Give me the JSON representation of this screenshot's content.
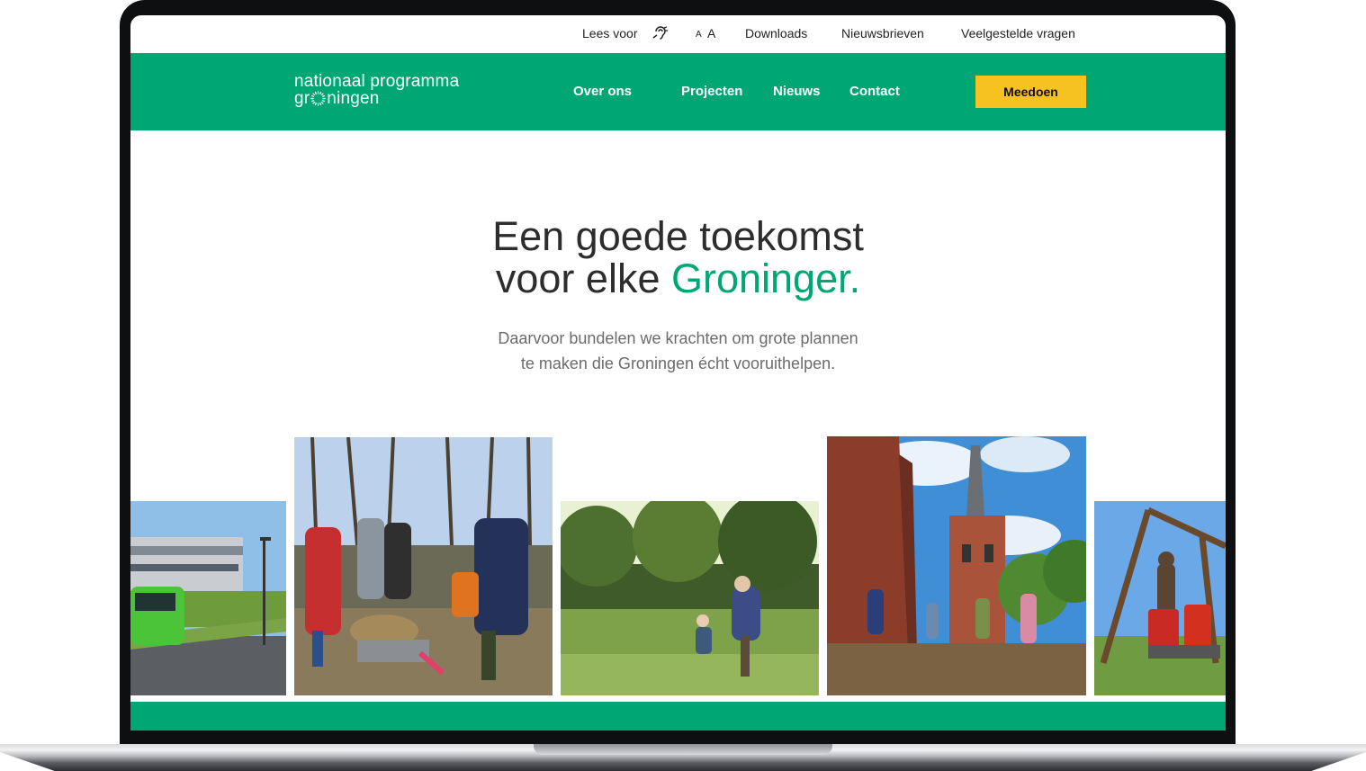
{
  "utility_nav": {
    "read_aloud": "Lees voor",
    "text_size_small": "A",
    "text_size_large": "A",
    "downloads": "Downloads",
    "newsletters": "Nieuwsbrieven",
    "faq": "Veelgestelde vragen"
  },
  "logo": {
    "line1": "nationaal programma",
    "line2_start": "gr",
    "line2_end": "ningen"
  },
  "main_nav": {
    "items": [
      "Over ons",
      "Projecten",
      "Nieuws",
      "Contact"
    ],
    "cta": "Meedoen"
  },
  "hero": {
    "title_line1": "Een goede toekomst",
    "title_line2_start": "voor elke ",
    "title_highlight": "Groninger.",
    "subtitle_line1": "Daarvoor bundelen we krachten om grote plannen",
    "subtitle_line2": "te maken die Groningen écht vooruithelpen."
  },
  "colors": {
    "brand_green": "#00a775",
    "cta_yellow": "#f6c221",
    "text_dark": "#2d2d2d",
    "text_muted": "#6b6b6b"
  },
  "icons": {
    "read_aloud": "ear-icon",
    "logo_mark": "sun-icon"
  }
}
